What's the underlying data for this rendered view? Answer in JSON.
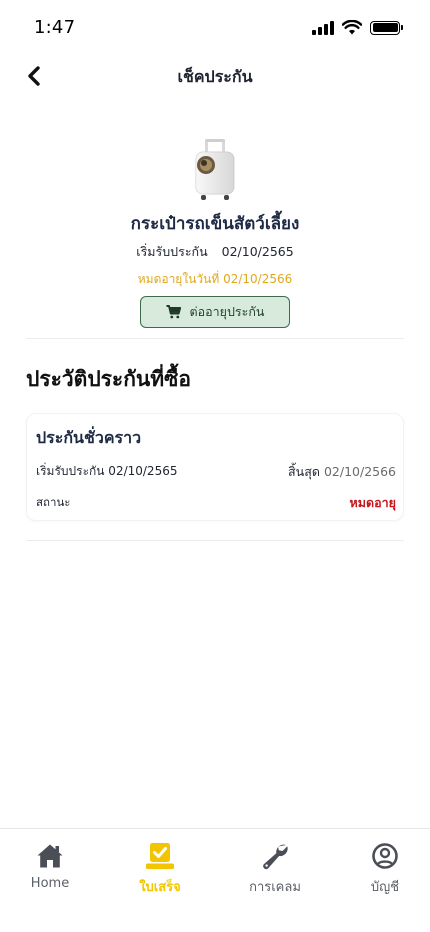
{
  "status_bar": {
    "time": "1:47"
  },
  "header": {
    "title": "เช็คประกัน"
  },
  "product": {
    "name": "กระเป๋ารถเข็นสัตว์เลี้ยง",
    "start_label": "เริ่มรับประกัน",
    "start_date": "02/10/2565",
    "expiry_text": "หมดอายุในวันที่ 02/10/2566",
    "renew_button": "ต่ออายุประกัน"
  },
  "history": {
    "title": "ประวัติประกันที่ซื้อ",
    "items": [
      {
        "name": "ประกันชั่วคราว",
        "start_text": "เริ่มรับประกัน 02/10/2565",
        "end_label": "สิ้นสุด",
        "end_date": "02/10/2566",
        "status_label": "สถานะ",
        "status_value": "หมดอายุ"
      }
    ]
  },
  "tabs": [
    {
      "label": "Home",
      "icon": "home-icon",
      "active": false
    },
    {
      "label": "ใบเสร็จ",
      "icon": "receipt-check-icon",
      "active": true
    },
    {
      "label": "การเคลม",
      "icon": "wrench-icon",
      "active": false
    },
    {
      "label": "บัญชี",
      "icon": "user-circle-icon",
      "active": false
    }
  ],
  "colors": {
    "accent": "#f2c500",
    "expiry_text": "#e0a81e",
    "renew_button_bg": "#d8eadb",
    "renew_button_border": "#3f6b4c",
    "expired_status": "#c4161c",
    "inactive_tab": "#5b5f66"
  }
}
